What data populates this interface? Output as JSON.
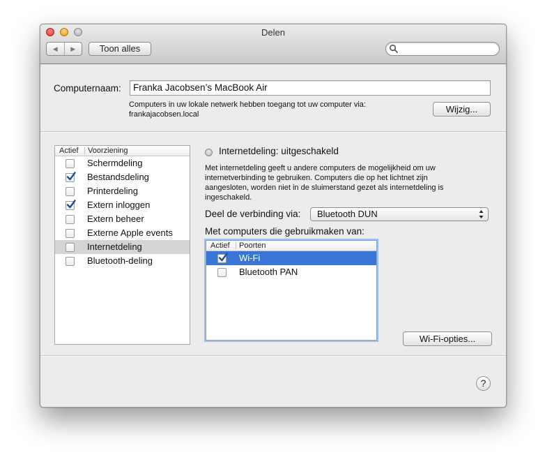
{
  "window": {
    "title": "Delen",
    "toolbar": {
      "show_all_label": "Toon alles",
      "search_value": "",
      "back_glyph": "◀",
      "forward_glyph": "▶"
    }
  },
  "computer_name": {
    "label": "Computernaam:",
    "value": "Franka Jacobsen’s MacBook Air",
    "info_line1": "Computers in uw lokale netwerk hebben toegang tot uw computer via:",
    "info_line2": "frankajacobsen.local",
    "edit_button": "Wijzig..."
  },
  "services": {
    "header_active": "Actief",
    "header_service": "Voorziening",
    "items": [
      {
        "label": "Schermdeling",
        "checked": false,
        "selected": false
      },
      {
        "label": "Bestandsdeling",
        "checked": true,
        "selected": false
      },
      {
        "label": "Printerdeling",
        "checked": false,
        "selected": false
      },
      {
        "label": "Extern inloggen",
        "checked": true,
        "selected": false
      },
      {
        "label": "Extern beheer",
        "checked": false,
        "selected": false
      },
      {
        "label": "Externe Apple events",
        "checked": false,
        "selected": false
      },
      {
        "label": "Internetdeling",
        "checked": false,
        "selected": true
      },
      {
        "label": "Bluetooth-deling",
        "checked": false,
        "selected": false
      }
    ]
  },
  "detail": {
    "status": "Internetdeling: uitgeschakeld",
    "description": "Met internetdeling geeft u andere computers de mogelijkheid om uw internetverbinding te gebruiken. Computers die op het lichtnet zijn aangesloten, worden niet in de sluimerstand gezet als internetdeling is ingeschakeld.",
    "share_via_label": "Deel de verbinding via:",
    "share_via_value": "Bluetooth DUN",
    "to_computers_label": "Met computers die gebruikmaken van:",
    "ports": {
      "header_active": "Actief",
      "header_ports": "Poorten",
      "items": [
        {
          "label": "Wi-Fi",
          "checked": true,
          "selected": true
        },
        {
          "label": "Bluetooth PAN",
          "checked": false,
          "selected": false
        }
      ]
    },
    "wifi_options_button": "Wi-Fi-opties..."
  },
  "help_glyph": "?",
  "colors": {
    "selection_blue": "#3875d7",
    "check_blue": "#1d4f9c",
    "selection_gray": "#d4d4d4"
  }
}
